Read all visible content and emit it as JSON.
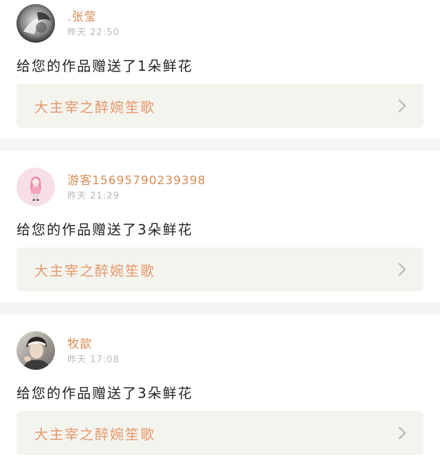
{
  "feed": {
    "items": [
      {
        "user": ".张莹",
        "time": "昨天 22:50",
        "message": "给您的作品赠送了1朵鲜花",
        "work_title": "大主宰之醉婉笙歌",
        "avatar": "avatar-dark-photo"
      },
      {
        "user": "游客15695790239398",
        "time": "昨天 21:29",
        "message": "给您的作品赠送了3朵鲜花",
        "work_title": "大主宰之醉婉笙歌",
        "avatar": "avatar-pink-girl"
      },
      {
        "user": "牧歆",
        "time": "昨天 17:08",
        "message": "给您的作品赠送了3朵鲜花",
        "work_title": "大主宰之醉婉笙歌",
        "avatar": "avatar-boy-photo"
      }
    ]
  },
  "colors": {
    "username": "#d98b55",
    "work_title": "#e5976a",
    "card_bg": "#f4f4ef",
    "separator": "#f7f4f4",
    "time": "#b8b8b8"
  },
  "icons": {
    "chevron": "chevron-right-icon"
  }
}
